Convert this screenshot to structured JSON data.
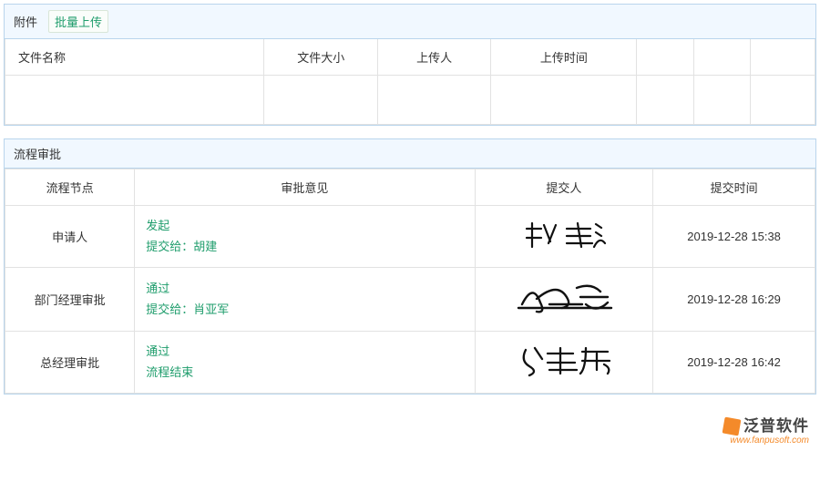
{
  "attachments": {
    "title": "附件",
    "bulk_upload": "批量上传",
    "columns": {
      "file_name": "文件名称",
      "file_size": "文件大小",
      "uploader": "上传人",
      "upload_time": "上传时间"
    },
    "rows": []
  },
  "approval": {
    "title": "流程审批",
    "columns": {
      "node": "流程节点",
      "opinion": "审批意见",
      "submitter": "提交人",
      "submit_time": "提交时间"
    },
    "rows": [
      {
        "node": "申请人",
        "opinion_action": "发起",
        "opinion_to_label": "提交给：",
        "opinion_to_name": "胡建",
        "submitter_signature": "张鑫",
        "submit_time": "2019-12-28 15:38"
      },
      {
        "node": "部门经理审批",
        "opinion_action": "通过",
        "opinion_to_label": "提交给：",
        "opinion_to_name": "肖亚军",
        "submitter_signature": "胡建",
        "submit_time": "2019-12-28 16:29"
      },
      {
        "node": "总经理审批",
        "opinion_action": "通过",
        "opinion_to_label": "流程结束",
        "opinion_to_name": "",
        "submitter_signature": "肖亚军",
        "submit_time": "2019-12-28 16:42"
      }
    ]
  },
  "brand": {
    "name": "泛普软件",
    "url": "www.fanpusoft.com"
  }
}
